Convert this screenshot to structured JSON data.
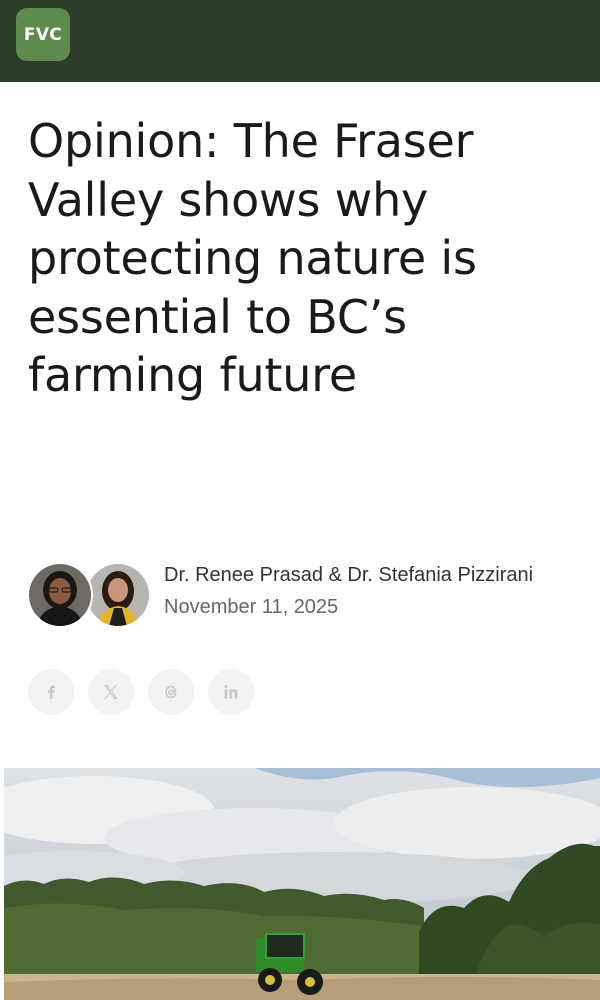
{
  "header": {
    "logo_text": "FVC",
    "bg_color": "#2e3d2a",
    "logo_color": "#5f8a4e"
  },
  "article": {
    "title": "Opinion: The Fraser Valley shows why protecting nature is essential to BC’s farming future",
    "authors": "Dr. Renee Prasad & Dr. Stefania Pizzirani",
    "date": "November 11, 2025"
  },
  "share": {
    "icons": [
      "facebook-icon",
      "x-icon",
      "threads-icon",
      "linkedin-icon"
    ]
  },
  "hero_image": {
    "subject": "green tractor ploughing a field under a cloudy sky"
  }
}
